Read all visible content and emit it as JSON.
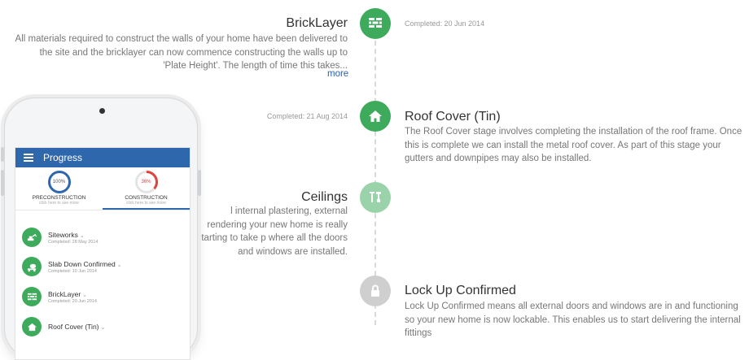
{
  "timeline": {
    "items": [
      {
        "title": "BrickLayer",
        "description": "All materials required to construct the walls of your home have been delivered to the site and the bricklayer can now commence constructing the walls up to 'Plate Height'. The length of time this takes...",
        "completed": "Completed: 20 Jun 2014",
        "more": "more",
        "icon": "brick-wall-icon",
        "status": "complete"
      },
      {
        "title": "Roof Cover (Tin)",
        "description": "The Roof Cover stage involves completing the installation of the roof frame. Once this is complete we can install the metal roof cover. As part of this stage your gutters and downpipes may also be installed.",
        "completed": "Completed: 21 Aug 2014",
        "icon": "house-icon",
        "status": "complete"
      },
      {
        "title": "Ceilings",
        "description": "l internal plastering, external rendering your new home is really starting to take p where all the doors and windows are installed.",
        "icon": "plaster-tools-icon",
        "status": "in-progress"
      },
      {
        "title": "Lock Up Confirmed",
        "description": "Lock Up Confirmed means all external doors and windows are in and functioning so your new home is now lockable. This enables us to start delivering the internal fittings",
        "icon": "padlock-icon",
        "status": "pending"
      }
    ]
  },
  "phone": {
    "app_title": "Progress",
    "stages": [
      {
        "percent": "100%",
        "label": "PRECONSTRUCTION",
        "sub": "click here to see more"
      },
      {
        "percent": "36%",
        "label": "CONSTRUCTION",
        "sub": "click here to see more",
        "progress": 0.36
      }
    ],
    "tasks": [
      {
        "name": "Siteworks",
        "date": "Completed: 28 May 2014",
        "icon": "excavator-icon"
      },
      {
        "name": "Slab Down Confirmed",
        "date": "Completed: 10 Jun 2014",
        "icon": "concrete-mixer-icon"
      },
      {
        "name": "BrickLayer",
        "date": "Completed: 20 Jun 2014",
        "icon": "brick-wall-icon"
      },
      {
        "name": "Roof Cover (Tin)",
        "date": "",
        "icon": "house-icon"
      }
    ]
  },
  "colors": {
    "complete": "#3daa5c",
    "in_progress": "#9ad3a9",
    "pending": "#cfcfcf",
    "app_bar": "#2f67ad",
    "ring_complete": "#2f67ad",
    "ring_progress": "#e0423f",
    "link": "#2d5fa8"
  }
}
